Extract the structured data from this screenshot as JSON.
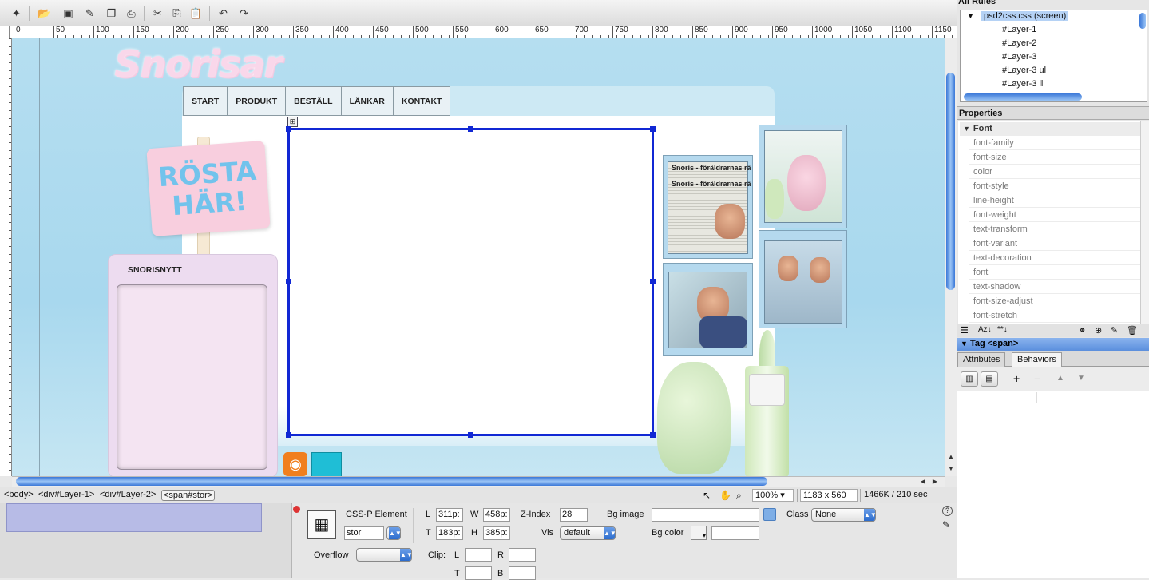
{
  "ruler": {
    "labels": [
      "0",
      "50",
      "100",
      "150",
      "200",
      "250",
      "300",
      "350",
      "400",
      "450",
      "500",
      "550",
      "600",
      "650",
      "700",
      "750",
      "800",
      "850",
      "900",
      "950",
      "1000",
      "1050",
      "1100",
      "1150"
    ]
  },
  "site": {
    "logo": "Snorisar",
    "nav": [
      "START",
      "PRODUKT",
      "BESTÄLL",
      "LÄNKAR",
      "KONTAKT"
    ],
    "sign_line1": "RÖSTA",
    "sign_line2": "HÄR!",
    "news_title": "SNORISNYTT",
    "clip_headline_1": "Snoris - föräldrarnas rä",
    "clip_headline_2": "Snoris - föräldrarnas rä",
    "rss_icon": "rss-icon",
    "twitter_icon": "twitter-icon"
  },
  "statusbar": {
    "crumbs": [
      "<body>",
      "<div#Layer-1>",
      "<div#Layer-2>",
      "<span#stor>"
    ],
    "zoom": "100%",
    "window_size": "1183 x 560",
    "download": "1466K / 210 sec"
  },
  "inspector": {
    "element_label": "CSS-P Element",
    "element_id": "stor",
    "L_label": "L",
    "L_value": "311p:",
    "W_label": "W",
    "W_value": "458p:",
    "T_label": "T",
    "T_value": "183p:",
    "H_label": "H",
    "H_value": "385p:",
    "zindex_label": "Z-Index",
    "zindex_value": "28",
    "vis_label": "Vis",
    "vis_value": "default",
    "bg_image_label": "Bg image",
    "bg_image_value": "",
    "bg_color_label": "Bg color",
    "bg_color_value": "",
    "class_label": "Class",
    "class_value": "None",
    "overflow_label": "Overflow",
    "overflow_value": "",
    "clip_label": "Clip:",
    "clip_L": "L",
    "clip_R": "R",
    "clip_T": "T",
    "clip_B": "B"
  },
  "panel": {
    "all_rules_title": "All Rules",
    "stylesheet": "psd2css.css (screen)",
    "rules": [
      "#Layer-1",
      "#Layer-2",
      "#Layer-3",
      "#Layer-3 ul",
      "#Layer-3 li"
    ],
    "properties_title": "Properties",
    "font_group": "Font",
    "properties": [
      "font-family",
      "font-size",
      "color",
      "font-style",
      "line-height",
      "font-weight",
      "text-transform",
      "font-variant",
      "text-decoration",
      "font",
      "text-shadow",
      "font-size-adjust",
      "font-stretch"
    ],
    "tag_header": "Tag <span>",
    "tab_attributes": "Attributes",
    "tab_behaviors": "Behaviors"
  },
  "colors": {
    "selection": "#1128d4",
    "canvas_bg": "#b5def0",
    "nav_bg": "#e9f1f5",
    "sign": "#f8cede",
    "sign_text": "#72c3ec"
  }
}
